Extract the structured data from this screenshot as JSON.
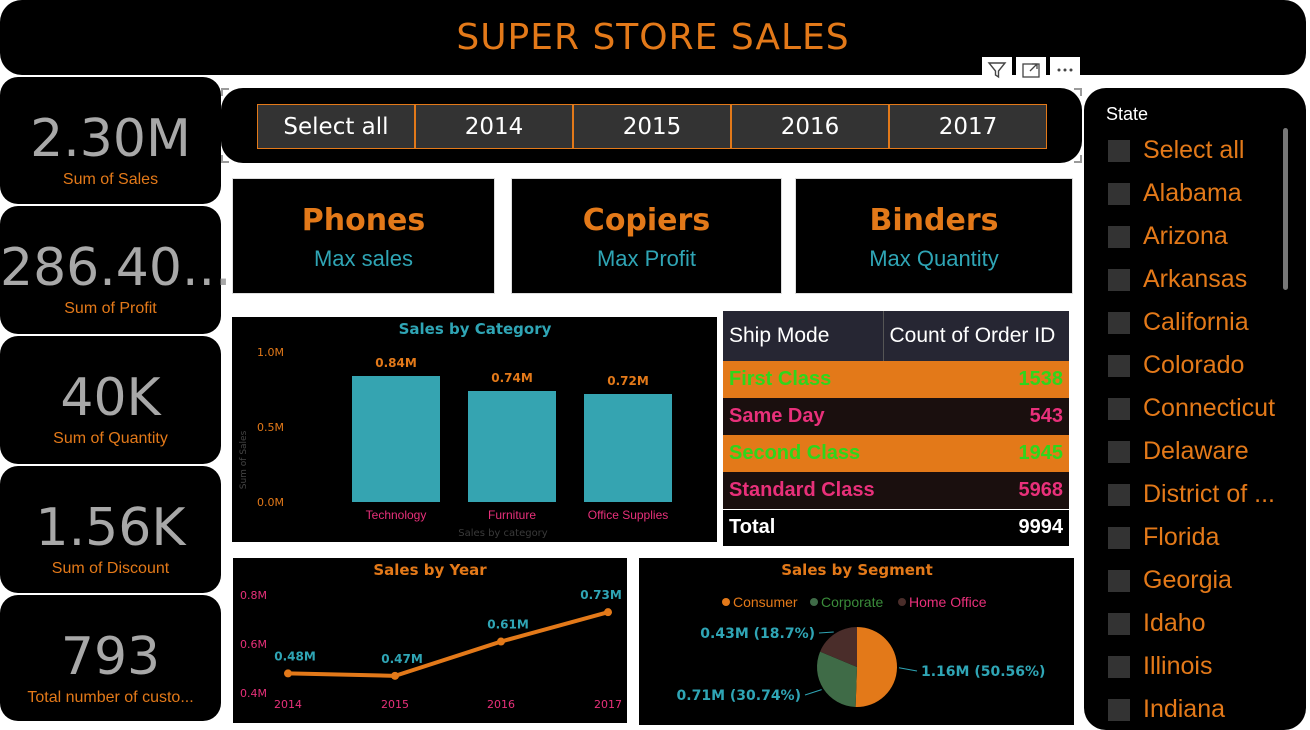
{
  "title": "SUPER STORE SALES",
  "kpis": [
    {
      "value": "2.30M",
      "label": "Sum of Sales"
    },
    {
      "value": "286.40...",
      "label": "Sum of Profit"
    },
    {
      "value": "40K",
      "label": "Sum of Quantity"
    },
    {
      "value": "1.56K",
      "label": "Sum of Discount"
    },
    {
      "value": "793",
      "label": "Total number of custo..."
    }
  ],
  "visual_header": {
    "icons": [
      "filter-icon",
      "focus-mode-icon",
      "more-options-icon"
    ]
  },
  "year_slicer": {
    "options": [
      "Select all",
      "2014",
      "2015",
      "2016",
      "2017"
    ],
    "selected": "Select all"
  },
  "cards": [
    {
      "value": "Phones",
      "label": "Max sales"
    },
    {
      "value": "Copiers",
      "label": "Max Profit"
    },
    {
      "value": "Binders",
      "label": "Max Quantity"
    }
  ],
  "ship_table": {
    "headers": [
      "Ship Mode",
      "Count of Order ID"
    ],
    "rows": [
      {
        "mode": "First Class",
        "count": "1538"
      },
      {
        "mode": "Same Day",
        "count": "543"
      },
      {
        "mode": "Second Class",
        "count": "1945"
      },
      {
        "mode": "Standard Class",
        "count": "5968"
      }
    ],
    "total": {
      "label": "Total",
      "count": "9994"
    }
  },
  "state_slicer": {
    "header": "State",
    "items": [
      "Select all",
      "Alabama",
      "Arizona",
      "Arkansas",
      "California",
      "Colorado",
      "Connecticut",
      "Delaware",
      "District of ...",
      "Florida",
      "Georgia",
      "Idaho",
      "Illinois",
      "Indiana"
    ]
  },
  "colors": {
    "accent": "#e37919",
    "teal": "#2fa5b5",
    "pink": "#e8307a",
    "green": "#3a8c3a",
    "bar": "#35a4b1"
  },
  "chart_data": [
    {
      "type": "bar",
      "title": "Sales by Category",
      "categories": [
        "Technology",
        "Furniture",
        "Office Supplies"
      ],
      "values": [
        0.84,
        0.74,
        0.72
      ],
      "data_labels": [
        "0.84M",
        "0.74M",
        "0.72M"
      ],
      "xlabel": "Sales by category",
      "ylabel": "Sum of Sales",
      "yticks": [
        "0.0M",
        "0.5M",
        "1.0M"
      ],
      "ylim": [
        0,
        1.0
      ]
    },
    {
      "type": "line",
      "title": "Sales by Year",
      "x": [
        "2014",
        "2015",
        "2016",
        "2017"
      ],
      "values": [
        0.48,
        0.47,
        0.61,
        0.73
      ],
      "data_labels": [
        "0.48M",
        "0.47M",
        "0.61M",
        "0.73M"
      ],
      "yticks": [
        "0.4M",
        "0.6M",
        "0.8M"
      ],
      "ylim": [
        0.4,
        0.8
      ]
    },
    {
      "type": "pie",
      "title": "Sales by Segment",
      "legend": [
        "Consumer",
        "Corporate",
        "Home Office"
      ],
      "values": [
        50.56,
        30.74,
        18.7
      ],
      "data_labels": [
        "1.16M (50.56%)",
        "0.71M (30.74%)",
        "0.43M (18.7%)"
      ],
      "colors": [
        "#e37919",
        "#3f6b47",
        "#4a2d2a"
      ]
    }
  ]
}
